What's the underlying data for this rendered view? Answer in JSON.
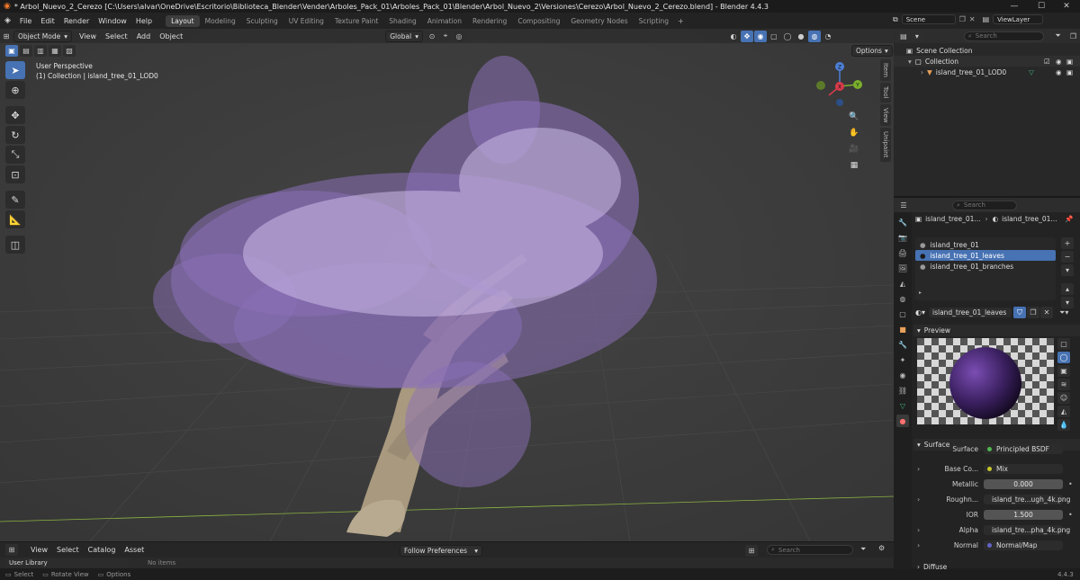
{
  "window": {
    "title": "* Arbol_Nuevo_2_Cerezo [C:\\Users\\alvar\\OneDrive\\Escritorio\\Biblioteca_Blender\\Vender\\Arboles_Pack_01\\Arboles_Pack_01\\Blender\\Arbol_Nuevo_2\\Versiones\\Cerezo\\Arbol_Nuevo_2_Cerezo.blend] - Blender 4.4.3",
    "minimize": "—",
    "maximize": "☐",
    "close": "✕"
  },
  "menubar": [
    "File",
    "Edit",
    "Render",
    "Window",
    "Help"
  ],
  "workspaces": [
    {
      "label": "Layout",
      "active": true
    },
    {
      "label": "Modeling",
      "active": false
    },
    {
      "label": "Sculpting",
      "active": false
    },
    {
      "label": "UV Editing",
      "active": false
    },
    {
      "label": "Texture Paint",
      "active": false
    },
    {
      "label": "Shading",
      "active": false
    },
    {
      "label": "Animation",
      "active": false
    },
    {
      "label": "Rendering",
      "active": false
    },
    {
      "label": "Compositing",
      "active": false
    },
    {
      "label": "Geometry Nodes",
      "active": false
    },
    {
      "label": "Scripting",
      "active": false
    }
  ],
  "add_workspace": "+",
  "scene": {
    "name": "Scene",
    "view_layer": "ViewLayer"
  },
  "viewport": {
    "mode": "Object Mode",
    "menus": [
      "View",
      "Select",
      "Add",
      "Object"
    ],
    "transform_orientation": "Global",
    "options_label": "Options",
    "overlay_title": "User Perspective",
    "overlay_subtitle": "(1) Collection | island_tree_01_LOD0",
    "side_tabs": [
      "Item",
      "Tool",
      "View",
      "Unipaint"
    ],
    "gizmo": {
      "x": "X",
      "y": "Y",
      "z": "Z"
    },
    "accent": "#4772b3"
  },
  "asset_browser": {
    "menus": [
      "View",
      "Select",
      "Catalog",
      "Asset"
    ],
    "library": "User Library",
    "preferences": "Follow Preferences",
    "search_placeholder": "Search",
    "no_items": "No items"
  },
  "statusbar": {
    "select": "Select",
    "rotate": "Rotate View",
    "options": "Options",
    "version": "4.4.3"
  },
  "outliner": {
    "search_placeholder": "Search",
    "root": "Scene Collection",
    "collection": "Collection",
    "object": "island_tree_01_LOD0"
  },
  "properties": {
    "search_placeholder": "Search",
    "breadcrumb_object": "island_tree_01...",
    "breadcrumb_material": "island_tree_01...",
    "material_slots": [
      {
        "name": "island_tree_01",
        "selected": false
      },
      {
        "name": "island_tree_01_leaves",
        "selected": true
      },
      {
        "name": "island_tree_01_branches",
        "selected": false
      }
    ],
    "active_material": "island_tree_01_leaves",
    "preview_label": "Preview",
    "surface_section": "Surface",
    "fields": [
      {
        "label": "Surface",
        "value": "Principled BSDF",
        "dot": "#4fb74f",
        "expand": false,
        "kind": "dark"
      },
      {
        "label": "Base Co...",
        "value": "Mix",
        "dot": "#c7c729",
        "expand": true,
        "kind": "dark"
      },
      {
        "label": "Metallic",
        "value": "0.000",
        "dot": "",
        "expand": false,
        "kind": "num"
      },
      {
        "label": "Roughn...",
        "value": "island_tre...ugh_4k.png",
        "dot": "#a1a1a1",
        "expand": true,
        "kind": "dark"
      },
      {
        "label": "IOR",
        "value": "1.500",
        "dot": "",
        "expand": false,
        "kind": "num"
      },
      {
        "label": "Alpha",
        "value": "island_tre...pha_4k.png",
        "dot": "#a1a1a1",
        "expand": true,
        "kind": "dark"
      },
      {
        "label": "Normal",
        "value": "Normal/Map",
        "dot": "#6363c7",
        "expand": true,
        "kind": "dark"
      }
    ],
    "diffuse_section": "Diffuse"
  }
}
